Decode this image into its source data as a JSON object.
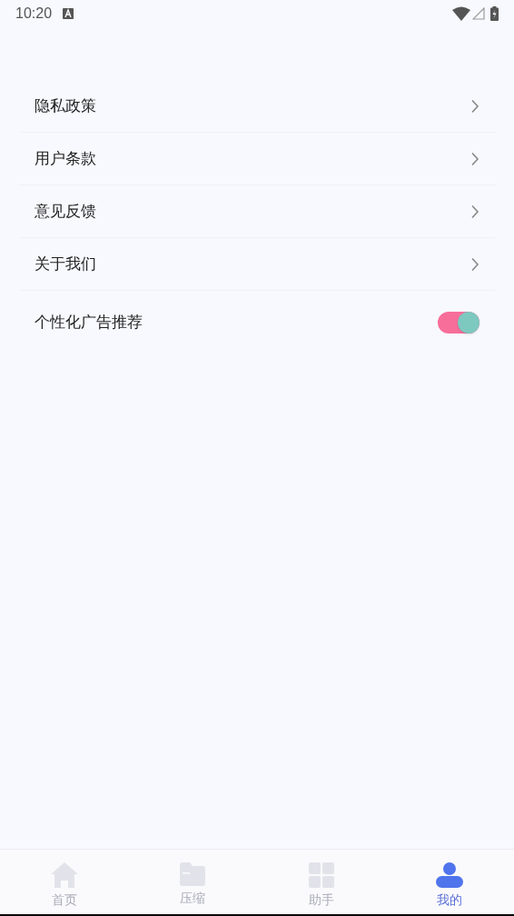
{
  "status_bar": {
    "time": "10:20"
  },
  "menu": [
    {
      "kind": "link",
      "label": "隐私政策"
    },
    {
      "kind": "link",
      "label": "用户条款"
    },
    {
      "kind": "link",
      "label": "意见反馈"
    },
    {
      "kind": "link",
      "label": "关于我们"
    },
    {
      "kind": "toggle",
      "label": "个性化广告推荐",
      "on": true
    }
  ],
  "tabs": [
    {
      "kind": "home",
      "label": "首页",
      "selected": false
    },
    {
      "kind": "folder",
      "label": "压缩",
      "selected": false
    },
    {
      "kind": "grid",
      "label": "助手",
      "selected": false
    },
    {
      "kind": "person",
      "label": "我的",
      "selected": true
    }
  ]
}
